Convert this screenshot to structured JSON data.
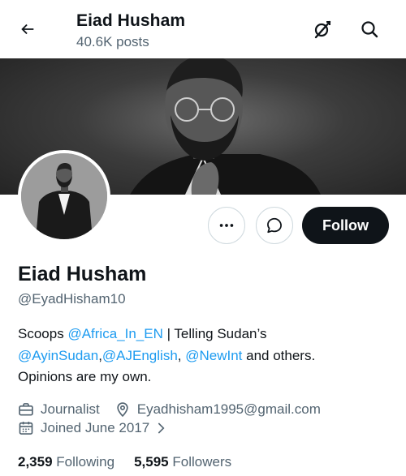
{
  "header": {
    "title": "Eiad Husham",
    "post_count": "40.6K posts"
  },
  "profile": {
    "name": "Eiad Husham",
    "handle": "@EyadHisham10",
    "follow_label": "Follow",
    "bio": {
      "t1": "Scoops ",
      "l1": "@Africa_In_EN",
      "t2": " | Telling Sudan’s",
      "l2": "@AyinSudan",
      "t3": ",",
      "l3": "@AJEnglish",
      "t4": ", ",
      "l4": "@NewInt",
      "t5": " and others.",
      "t6": "Opinions are my own."
    },
    "profession": "Journalist",
    "location": "Eyadhisham1995@gmail.com",
    "joined": "Joined June 2017"
  },
  "stats": {
    "following_count": "2,359",
    "following_label": "Following",
    "followers_count": "5,595",
    "followers_label": "Followers"
  },
  "colors": {
    "link": "#1d9bf0",
    "text": "#0f1419",
    "secondary": "#536471",
    "button_dark": "#0f1419"
  }
}
